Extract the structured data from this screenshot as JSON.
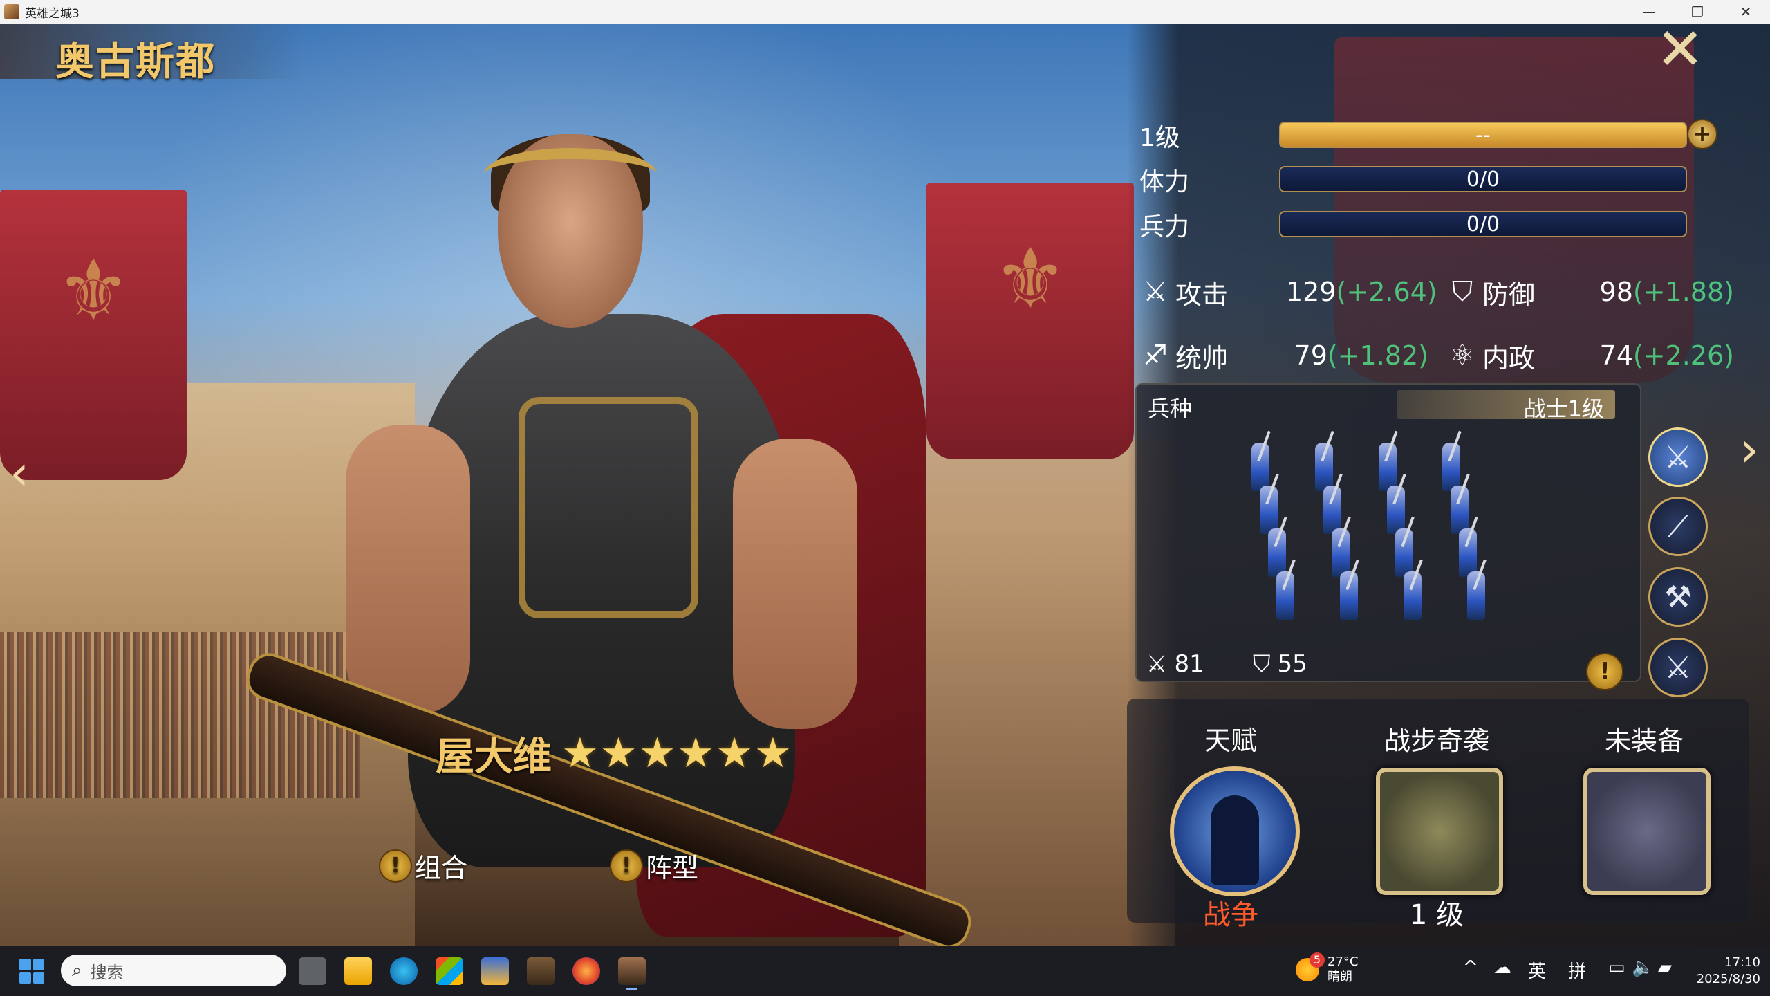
{
  "window": {
    "title": "英雄之城3",
    "minimize": "—",
    "maximize": "❐",
    "close": "✕"
  },
  "hero": {
    "title": "奥古斯都",
    "name": "屋大维",
    "stars": 6,
    "star_char": "★"
  },
  "nav": {
    "prev": "‹",
    "next": "›"
  },
  "close_glyph": "✕",
  "stats": {
    "level_label": "1级",
    "level_bar": "--",
    "stamina_label": "体力",
    "stamina_value": "0/0",
    "troops_label": "兵力",
    "troops_value": "0/0",
    "plus": "+"
  },
  "attributes": {
    "attack": {
      "label": "攻击",
      "base": "129",
      "bonus": "(+2.64)"
    },
    "defense": {
      "label": "防御",
      "base": "98",
      "bonus": "(+1.88)"
    },
    "command": {
      "label": "统帅",
      "base": "79",
      "bonus": "(+1.82)"
    },
    "politics": {
      "label": "内政",
      "base": "74",
      "bonus": "(+2.26)"
    }
  },
  "troop": {
    "title": "兵种",
    "level": "战士1级",
    "attack": "81",
    "defense": "55",
    "warn": "!"
  },
  "unit_types": [
    {
      "icon": "crossed-swords-icon",
      "glyph": "⚔",
      "active": true
    },
    {
      "icon": "spear-icon",
      "glyph": "⟋",
      "active": false
    },
    {
      "icon": "axe-icon",
      "glyph": "⚒",
      "active": false
    },
    {
      "icon": "bow-icon",
      "glyph": "⚔",
      "active": false
    }
  ],
  "skills": {
    "talent": {
      "title": "天赋",
      "sub": "战争"
    },
    "tactic": {
      "title": "战步奇袭",
      "sub": "1 级"
    },
    "equipment": {
      "title": "未装备"
    }
  },
  "links": {
    "combo": "组合",
    "formation": "阵型",
    "warn": "!"
  },
  "colors": {
    "gold_text": "#f2c86b",
    "bonus_green": "#4ec27b",
    "talent_red": "#ff5a2a"
  },
  "taskbar": {
    "search_placeholder": "搜索",
    "weather_badge": "5",
    "temperature": "27°C",
    "weather": "晴朗",
    "ime_lang": "英",
    "ime_mode": "拼",
    "chevron": "^",
    "time": "17:10",
    "date": "2025/8/30"
  }
}
